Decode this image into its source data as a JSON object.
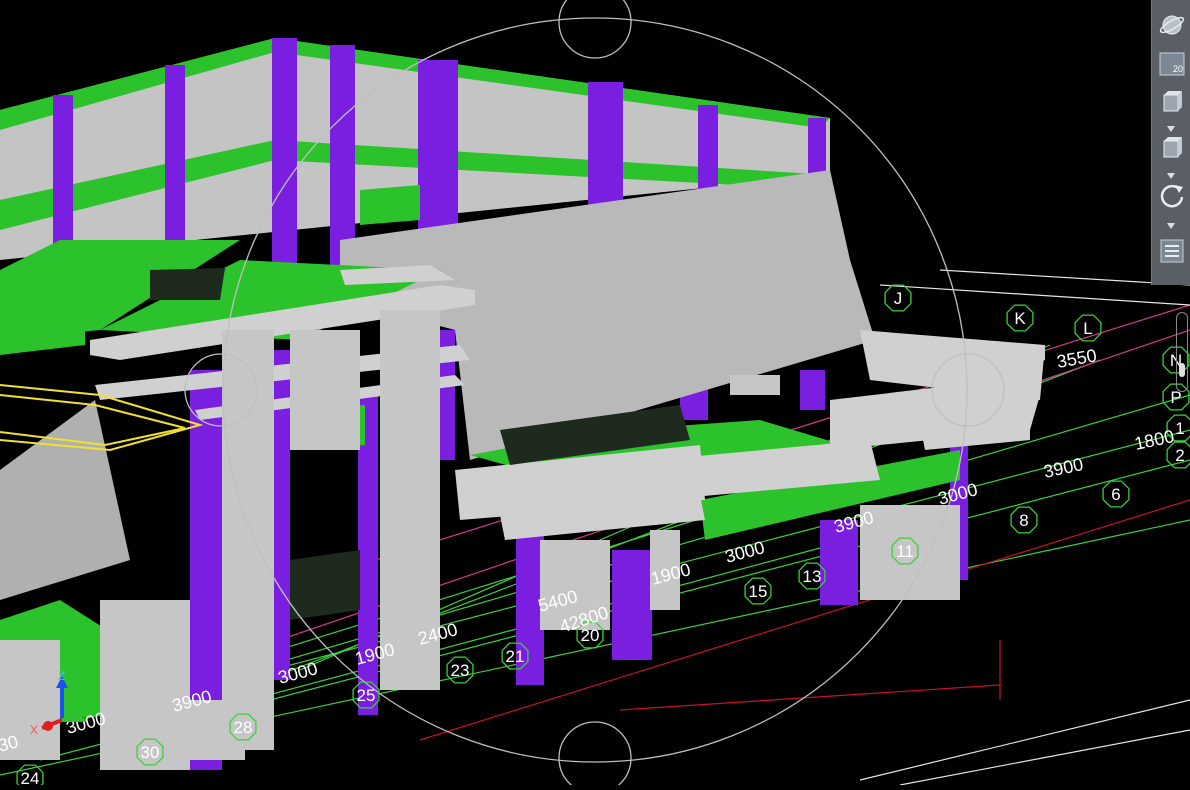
{
  "viewcube": {
    "ucs_z_label": "Z",
    "ucs_x_label": "X"
  },
  "toolbar": {
    "items": [
      {
        "icon": "navigation-wheel-icon"
      },
      {
        "icon": "show-motion-icon",
        "badge": "20"
      },
      {
        "icon": "view-cube-icon"
      },
      {
        "icon": "orbit-cube-icon"
      },
      {
        "icon": "orbit-rotate-icon"
      },
      {
        "icon": "properties-list-icon"
      }
    ]
  },
  "grid_bubbles": [
    "J",
    "K",
    "L",
    "N",
    "P",
    "1",
    "2",
    "6",
    "8",
    "11",
    "13",
    "15",
    "20",
    "21",
    "23",
    "25",
    "28",
    "30",
    "24"
  ],
  "dimensions": [
    "3550",
    "1800",
    "3900",
    "3000",
    "3900",
    "3000",
    "1900",
    "5400",
    "42800",
    "2400",
    "1900",
    "3000",
    "3900",
    "3000",
    "30"
  ],
  "colors": {
    "background": "#000000",
    "steel_columns": "#7a1fe0",
    "slabs_green": "#2bc22b",
    "concrete": "#b9b9b9",
    "grid_lines_green": "#39d139",
    "grid_lines_red": "#c8102e",
    "grid_lines_magenta": "#d33a8c",
    "highlight_yellow": "#f0e030",
    "orbit_circle": "#bfbfbf"
  }
}
